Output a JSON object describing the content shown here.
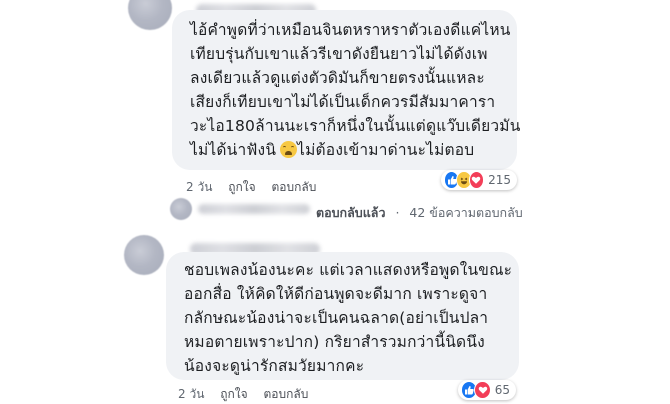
{
  "comments": [
    {
      "lines": [
        "ไอ้คำพูดที่ว่าเหมือนจินตหราหราตัวเองดีแค่ไหน",
        "เทียบรุ่นกับเขาแล้วรีเขาดังยืนยาวไม่ได้ดังเพ",
        "ลงเดียวแล้วดูแต่งตัวดิมันก็ขายตรงนั้นแหละ",
        "เสียงก็เทียบเขาไม่ได้เป็นเด็กควรมีสัมมาคารา",
        "วะไอ180ล้านนะเราก็หนึ่งในนั้นแต่ดูแว๊บเดียวมัน",
        "ไม่ได้น่าฟังนิ",
        "ไม่ต้องเข้ามาด่านะไม่ตอบ"
      ],
      "time": "2 วัน",
      "like_label": "ถูกใจ",
      "reply_label": "ตอบกลับ",
      "reaction_count": "215"
    },
    {
      "lines": [
        "ชอบเพลงน้องนะคะ แต่เวลาแสดงหรือพูดในขณะ",
        "ออกสื่อ  ให้คิดให้ดีก่อนพูดจะดีมาก เพราะดูจา",
        "กลักษณะน้องน่าจะเป็นคนฉลาด(อย่าเป็นปลา",
        "หมอตายเพราะปาก) กริยาสำรวมกว่านี้นิดนึง",
        "น้องจะดูน่ารักสมวัยมากคะ"
      ],
      "time": "2 วัน",
      "like_label": "ถูกใจ",
      "reply_label": "ตอบกลับ",
      "reaction_count": "65"
    }
  ],
  "reply_row": {
    "replied_label": "ตอบกลับแล้ว",
    "count_label": "42 ข้อความตอบกลับ"
  },
  "icons": {
    "emoji": "weary-face-icon",
    "like": "like-reaction-icon",
    "haha": "haha-reaction-icon",
    "love": "love-reaction-icon"
  },
  "colors": {
    "bubble": "#f0f2f5",
    "like": "#1877f2",
    "love": "#f33e58",
    "haha": "#f7c843"
  }
}
